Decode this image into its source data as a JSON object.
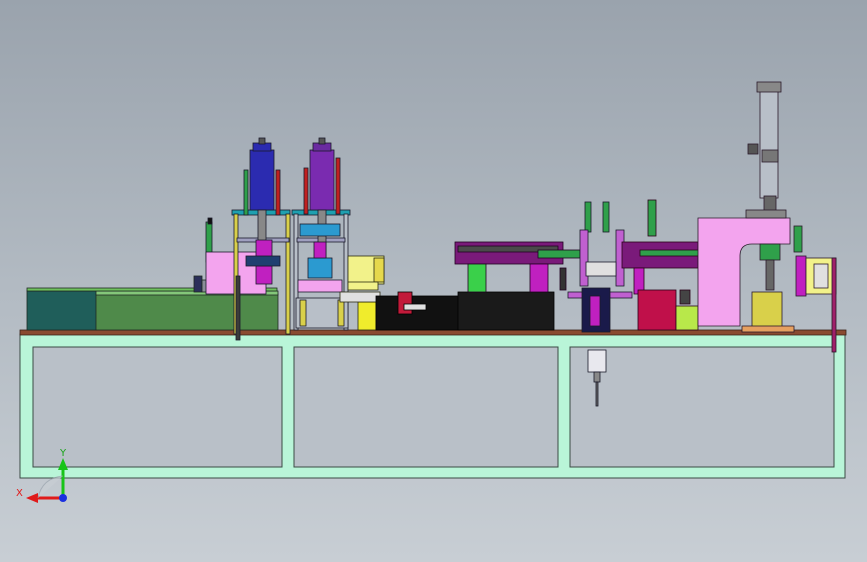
{
  "view": {
    "triad": {
      "x_label": "X",
      "y_label": "Y"
    }
  },
  "colors": {
    "background_top": "#9aa3ad",
    "background_bottom": "#c8ced4",
    "frame": "#b9f5d8",
    "frame_edge": "#3a4a44",
    "table_top": "#8a4a30",
    "axis_x": "#e01a1a",
    "axis_y": "#18c418",
    "axis_z": "#1a30e0"
  }
}
